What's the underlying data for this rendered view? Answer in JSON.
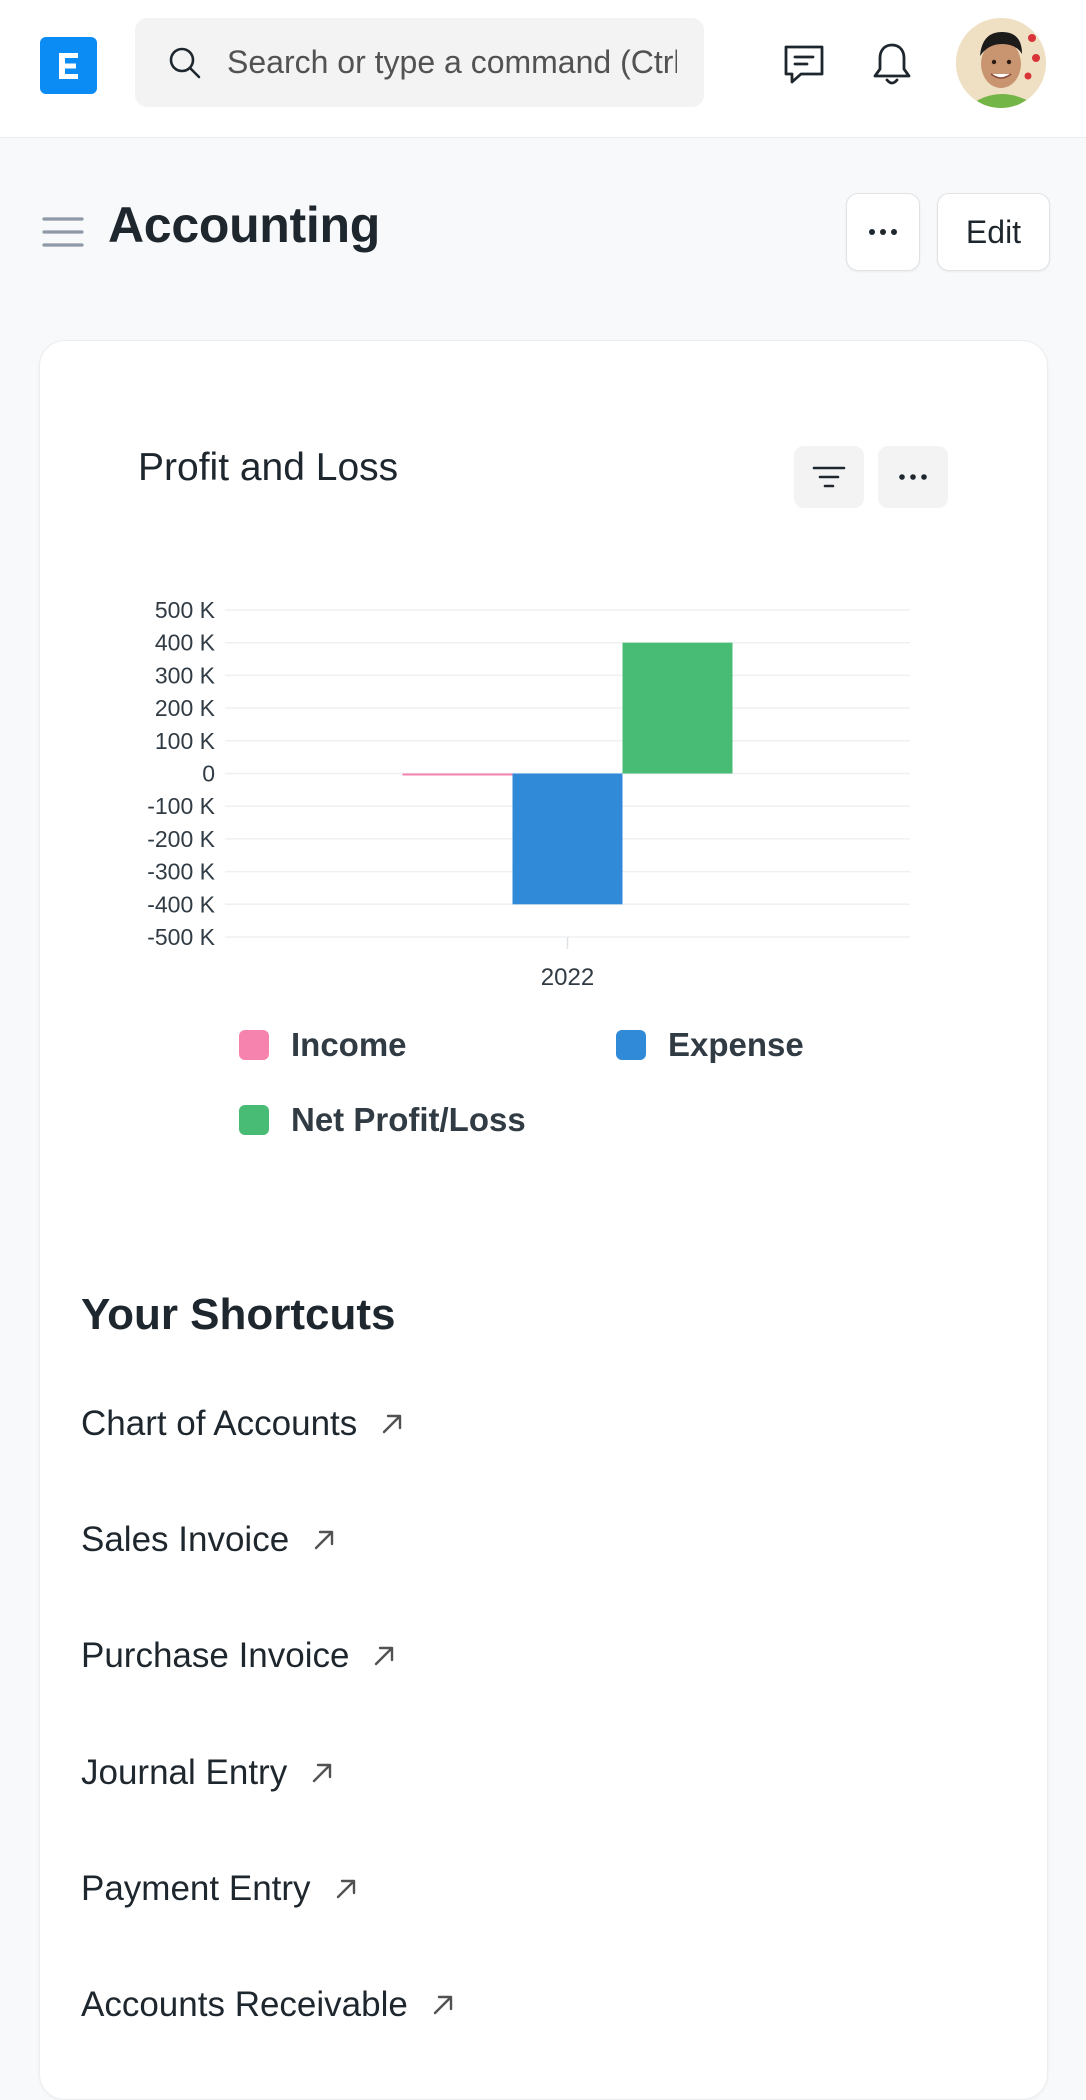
{
  "navbar": {
    "logo_letter": "E",
    "search_placeholder": "Search or type a command (Ctrl + G)"
  },
  "page": {
    "title": "Accounting",
    "more_label": "···",
    "edit_label": "Edit"
  },
  "chart_card": {
    "title": "Profit and Loss"
  },
  "chart_data": {
    "type": "bar",
    "title": "Profit and Loss",
    "categories": [
      "2022"
    ],
    "series": [
      {
        "name": "Income",
        "color": "#f683ae",
        "values": [
          0
        ]
      },
      {
        "name": "Expense",
        "color": "#318ad8",
        "values": [
          -400000
        ]
      },
      {
        "name": "Net Profit/Loss",
        "color": "#48bb74",
        "values": [
          400000
        ]
      }
    ],
    "ylim": [
      -500000,
      500000
    ],
    "y_ticks": [
      500000,
      400000,
      300000,
      200000,
      100000,
      0,
      -100000,
      -200000,
      -300000,
      -400000,
      -500000
    ],
    "y_tick_labels": [
      "500 K",
      "400 K",
      "300 K",
      "200 K",
      "100 K",
      "0",
      "-100 K",
      "-200 K",
      "-300 K",
      "-400 K",
      "-500 K"
    ],
    "grid": true,
    "legend_position": "bottom"
  },
  "legend": [
    {
      "label": "Income",
      "color": "#f683ae"
    },
    {
      "label": "Expense",
      "color": "#318ad8"
    },
    {
      "label": "Net Profit/Loss",
      "color": "#48bb74"
    }
  ],
  "shortcuts": {
    "title": "Your Shortcuts",
    "items": [
      {
        "label": "Chart of Accounts"
      },
      {
        "label": "Sales Invoice"
      },
      {
        "label": "Purchase Invoice"
      },
      {
        "label": "Journal Entry"
      },
      {
        "label": "Payment Entry"
      },
      {
        "label": "Accounts Receivable"
      }
    ]
  }
}
